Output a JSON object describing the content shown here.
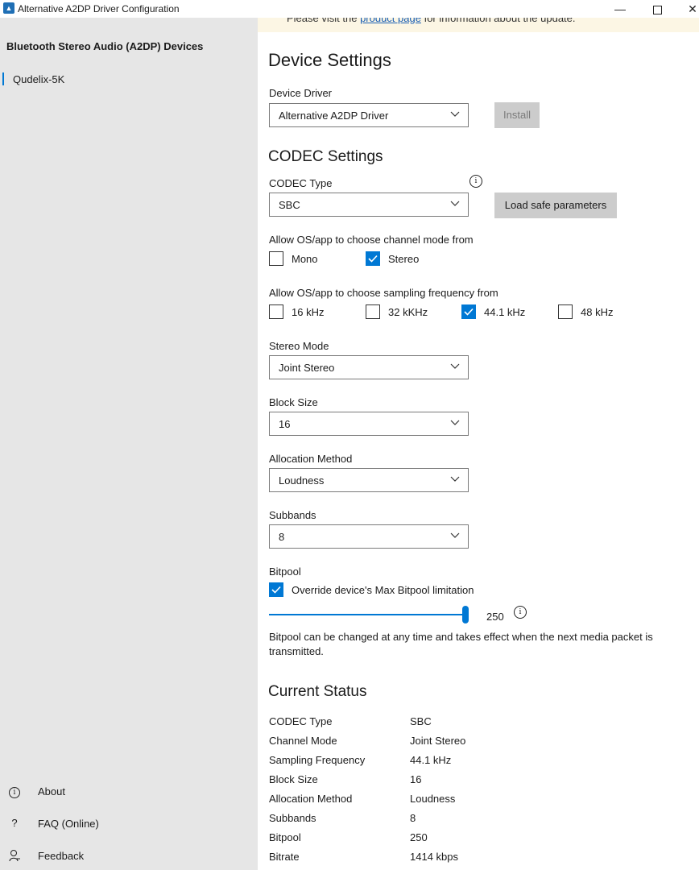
{
  "window": {
    "title": "Alternative A2DP Driver Configuration"
  },
  "sidebar": {
    "header": "Bluetooth Stereo Audio (A2DP) Devices",
    "device": "Qudelix-5K",
    "footer": {
      "about": "About",
      "faq": "FAQ (Online)",
      "feedback": "Feedback"
    }
  },
  "banner": {
    "prefix": "Please visit the",
    "link": "product page",
    "suffix": "for information about the update."
  },
  "device_settings": {
    "heading": "Device Settings",
    "driver_label": "Device Driver",
    "driver_value": "Alternative A2DP Driver",
    "install_label": "Install"
  },
  "codec_settings": {
    "heading": "CODEC Settings",
    "codec_type_label": "CODEC Type",
    "codec_type_value": "SBC",
    "load_safe_label": "Load safe parameters",
    "channel_mode_label": "Allow OS/app to choose channel mode from",
    "channel_modes": [
      {
        "label": "Mono",
        "checked": false
      },
      {
        "label": "Stereo",
        "checked": true
      }
    ],
    "sampling_label": "Allow OS/app to choose sampling frequency from",
    "sampling": [
      {
        "label": "16 kHz",
        "checked": false
      },
      {
        "label": "32 kKHz",
        "checked": false
      },
      {
        "label": "44.1 kHz",
        "checked": true
      },
      {
        "label": "48 kHz",
        "checked": false
      }
    ],
    "stereo_mode_label": "Stereo Mode",
    "stereo_mode_value": "Joint Stereo",
    "block_size_label": "Block Size",
    "block_size_value": "16",
    "allocation_label": "Allocation Method",
    "allocation_value": "Loudness",
    "subbands_label": "Subbands",
    "subbands_value": "8",
    "bitpool_label": "Bitpool",
    "override_label": "Override device's Max Bitpool limitation",
    "override_checked": true,
    "bitpool_value": "250",
    "bitpool_fraction": 1.0,
    "bitpool_help": "Bitpool can be changed at any time and takes effect when the next media packet is transmitted."
  },
  "current_status": {
    "heading": "Current Status",
    "rows": [
      {
        "key": "CODEC Type",
        "value": "SBC"
      },
      {
        "key": "Channel Mode",
        "value": "Joint Stereo"
      },
      {
        "key": "Sampling Frequency",
        "value": "44.1 kHz"
      },
      {
        "key": "Block Size",
        "value": "16"
      },
      {
        "key": "Allocation Method",
        "value": "Loudness"
      },
      {
        "key": "Subbands",
        "value": "8"
      },
      {
        "key": "Bitpool",
        "value": "250"
      },
      {
        "key": "Bitrate",
        "value": "1414 kbps"
      }
    ]
  },
  "colors": {
    "accent": "#0078d4",
    "sidebar_bg": "#e6e6e6",
    "banner_bg": "#fcf6e4"
  },
  "icons": [
    "app-icon",
    "info-icon",
    "question-icon",
    "feedback-icon",
    "chevron-down-icon",
    "checkmark-icon"
  ]
}
